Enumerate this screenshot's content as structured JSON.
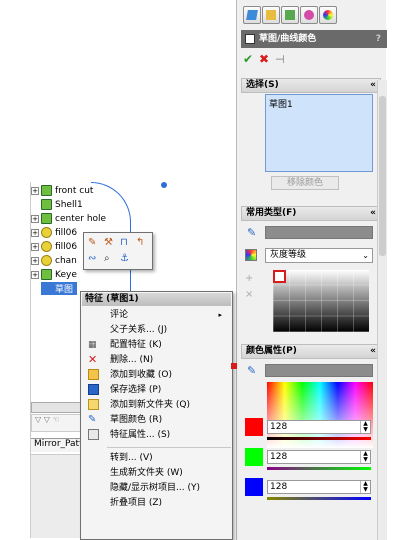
{
  "tree": {
    "items": [
      {
        "label": "front cut"
      },
      {
        "label": "Shell1"
      },
      {
        "label": "center hole"
      },
      {
        "label": "fill06"
      },
      {
        "label": "fill06"
      },
      {
        "label": "chan"
      },
      {
        "label": "Keye"
      },
      {
        "label": "草图"
      }
    ],
    "bottom_tab": "Mirror_Patt"
  },
  "panel": {
    "title": "草图/曲线颜色",
    "help": "?",
    "selection": {
      "header": "选择(S)",
      "item": "草图1",
      "remove_button": "移除颜色"
    },
    "common_types": {
      "header": "常用类型(F)",
      "dropdown": "灰度等级"
    },
    "color_props": {
      "header": "颜色属性(P)",
      "rgb": [
        {
          "color": "#ff0000",
          "value": "128"
        },
        {
          "color": "#00ff00",
          "value": "128"
        },
        {
          "color": "#0000ff",
          "value": "128"
        }
      ]
    }
  },
  "context_menu": {
    "title": "特征 (草图1)",
    "items": [
      {
        "label": "评论",
        "icon": "none",
        "submenu": true
      },
      {
        "label": "父子关系... (J)",
        "icon": "none"
      },
      {
        "label": "配置特征 (K)",
        "icon": "config-icon"
      },
      {
        "label": "删除... (N)",
        "icon": "delete-icon"
      },
      {
        "label": "添加到收藏 (O)",
        "icon": "favorite-icon"
      },
      {
        "label": "保存选择 (P)",
        "icon": "save-selection-icon"
      },
      {
        "label": "添加到新文件夹 (Q)",
        "icon": "folder-icon"
      },
      {
        "label": "草图颜色 (R)",
        "icon": "sketch-color-icon"
      },
      {
        "label": "特征属性... (S)",
        "icon": "properties-icon"
      },
      {
        "label": "转到... (V)",
        "icon": "none"
      },
      {
        "label": "生成新文件夹 (W)",
        "icon": "none"
      },
      {
        "label": "隐藏/显示树项目... (Y)",
        "icon": "none"
      },
      {
        "label": "折叠项目 (Z)",
        "icon": "none"
      }
    ]
  }
}
